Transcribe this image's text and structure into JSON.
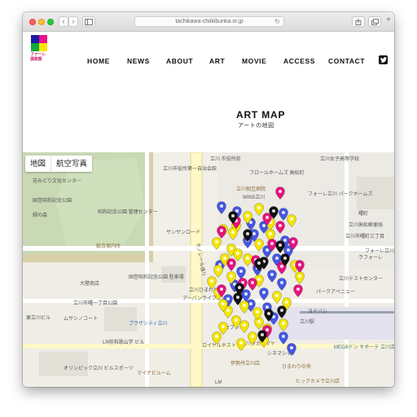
{
  "browser": {
    "url": "tachikawa-chiikibunka.or.jp",
    "back_glyph": "‹",
    "forward_glyph": "›",
    "reload_glyph": "↻"
  },
  "logo": {
    "text_line1": "ファーレ",
    "text_line2": "倶楽部",
    "colors": [
      "#1b1ba8",
      "#e8128a",
      "#0fa83a",
      "#f7e600"
    ]
  },
  "nav": {
    "items": [
      "HOME",
      "NEWS",
      "ABOUT",
      "ART",
      "MOVIE",
      "ACCESS",
      "CONTACT"
    ],
    "twitter_icon": "twitter-icon"
  },
  "section": {
    "title": "ART MAP",
    "subtitle": "アートの地図"
  },
  "map": {
    "type_control": [
      "地図",
      "航空写真"
    ],
    "labels": [
      "花みどり文化センター",
      "国営昭和記念公園",
      "昭和記念公園 管理センター",
      "緑の森",
      "立川 市役所前",
      "総合案内所",
      "サンサンロード",
      "立川市曙一丁目公園",
      "東立川ビル",
      "ムサシノコート",
      "プラザシティ立川",
      "LR前和歌山学 ビル",
      "オリンピック立川 ビルスポーツ",
      "マイナビルーム",
      "大壁商店",
      "立川ひまわり",
      "フォーレ立川 サンロード",
      "国営昭和記念公園 駐車場",
      "立川市役所第一自治会館",
      "フロールホームズ 高松町",
      "フォーレ立川 パークホームズ",
      "立川相互病院",
      "ヒックカメラ立川店",
      "ラフォーレ",
      "伊勢丹立川店",
      "MEGAドン キホーテ 立川店",
      "立川テストセンター",
      "立川女子高等学校",
      "立川高松郵便局",
      "パークアベニュー",
      "立川タカシマヤ",
      "立川駅",
      "ひまわり中央",
      "シネマシティ",
      "LM",
      "WINS立川",
      "立川市曙町三丁目",
      "曙町",
      "セブン",
      "ロイヤルホスト",
      "ヨドバシ",
      "ビル",
      "アーバンライフビル",
      "モノレール通り"
    ],
    "marker_colors": {
      "blue": "#4656e6",
      "yellow": "#f5e600",
      "magenta": "#e8127f",
      "black": "#111111"
    },
    "marker_counts": {
      "blue": 25,
      "yellow": 37,
      "magenta": 16,
      "black": 12
    }
  }
}
